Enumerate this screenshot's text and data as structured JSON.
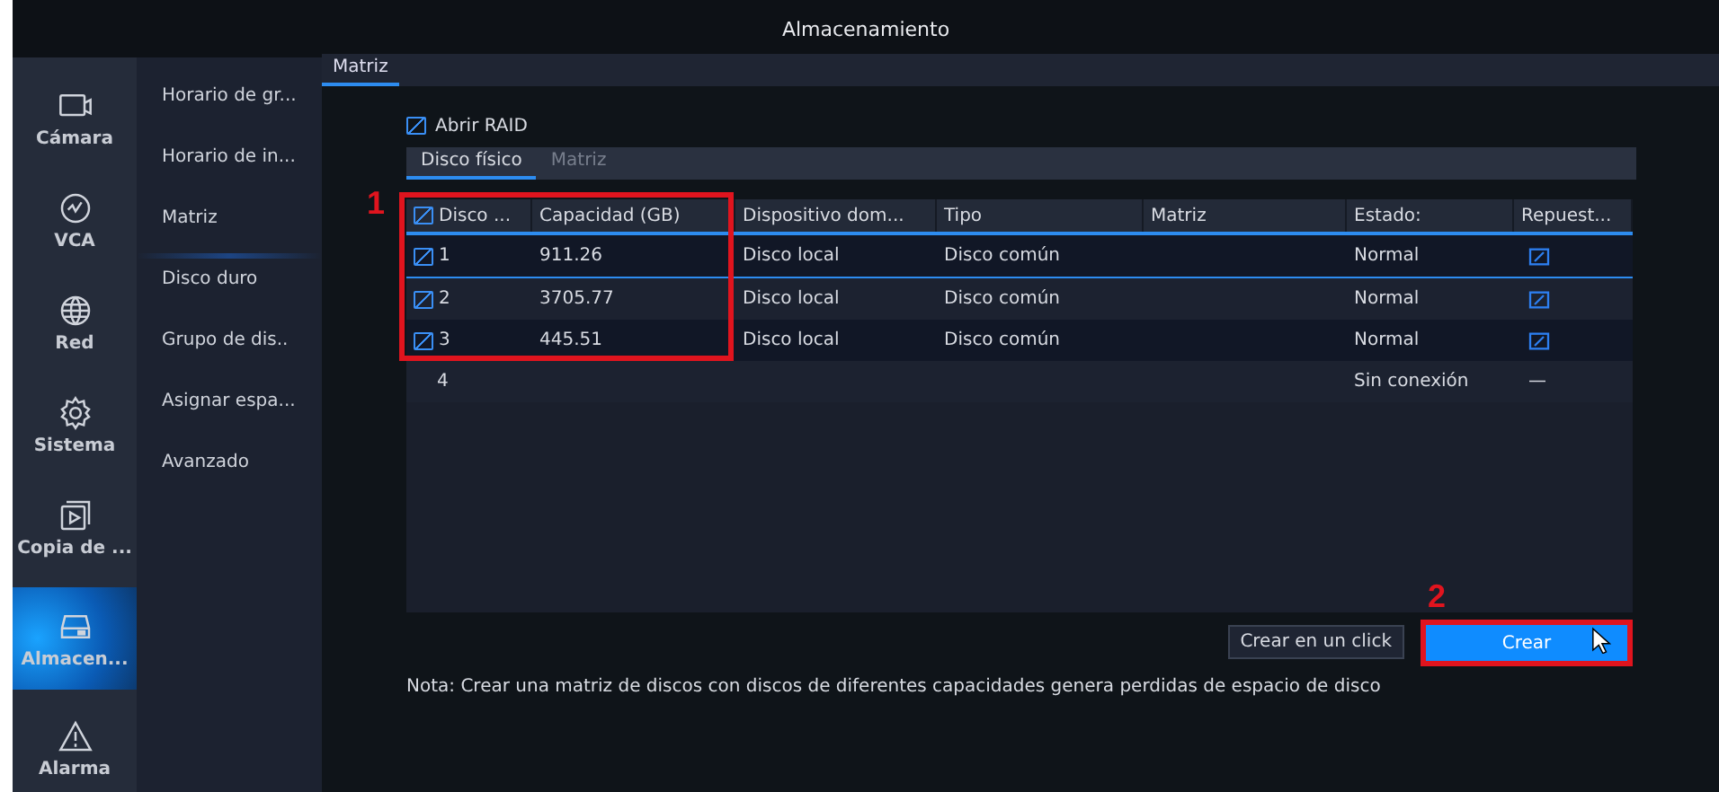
{
  "window": {
    "title": "Almacenamiento"
  },
  "sidebar": {
    "items": [
      {
        "label": "Cámara",
        "kind": "camera",
        "selected": false
      },
      {
        "label": "VCA",
        "kind": "vca",
        "selected": false
      },
      {
        "label": "Red",
        "kind": "network",
        "selected": false
      },
      {
        "label": "Sistema",
        "kind": "system",
        "selected": false
      },
      {
        "label": "Copia de ...",
        "kind": "backup",
        "selected": false
      },
      {
        "label": "Almacen...",
        "kind": "storage",
        "selected": true
      },
      {
        "label": "Alarma",
        "kind": "alarm",
        "selected": false
      }
    ]
  },
  "submenu": {
    "items": [
      {
        "label": "Horario de gr...",
        "selected": false
      },
      {
        "label": "Horario de in...",
        "selected": false
      },
      {
        "label": "Matriz",
        "selected": true
      },
      {
        "label": "Disco duro",
        "selected": false
      },
      {
        "label": "Grupo de dis..",
        "selected": false
      },
      {
        "label": "Asignar espa...",
        "selected": false
      },
      {
        "label": "Avanzado",
        "selected": false
      }
    ]
  },
  "page_tab": {
    "label": "Matriz",
    "selected": true
  },
  "open_raid": {
    "label": "Abrir RAID",
    "checked": true
  },
  "tabs": [
    {
      "label": "Disco físico",
      "selected": true
    },
    {
      "label": "Matriz",
      "selected": false
    }
  ],
  "table": {
    "header_checked": true,
    "columns": [
      "Disco ...",
      "Capacidad (GB)",
      "Dispositivo dom...",
      "Tipo",
      "Matriz",
      "Estado:",
      "Repuest..."
    ],
    "rows": [
      {
        "disk": "1",
        "checked": true,
        "selected": true,
        "capacity": "911.26",
        "device": "Disco local",
        "type": "Disco común",
        "status": "Normal",
        "spare": {
          "kind": "edit"
        }
      },
      {
        "disk": "2",
        "checked": true,
        "selected": false,
        "capacity": "3705.77",
        "device": "Disco local",
        "type": "Disco común",
        "status": "Normal",
        "spare": {
          "kind": "edit"
        }
      },
      {
        "disk": "3",
        "checked": true,
        "selected": false,
        "capacity": "445.51",
        "device": "Disco local",
        "type": "Disco común",
        "status": "Normal",
        "spare": {
          "kind": "edit"
        }
      },
      {
        "disk": "4",
        "selected": false,
        "status": "Sin conexión",
        "spare": {
          "kind": "text",
          "text": "—"
        }
      }
    ]
  },
  "buttons": [
    {
      "label": "Crear en un click",
      "kind": "secondary"
    },
    {
      "label": "Crear",
      "kind": "primary"
    }
  ],
  "note": "Nota: Crear una matriz de discos con discos de diferentes capacidades genera perdidas de espacio de disco",
  "annotations": [
    {
      "label": "1"
    },
    {
      "label": "2"
    }
  ]
}
